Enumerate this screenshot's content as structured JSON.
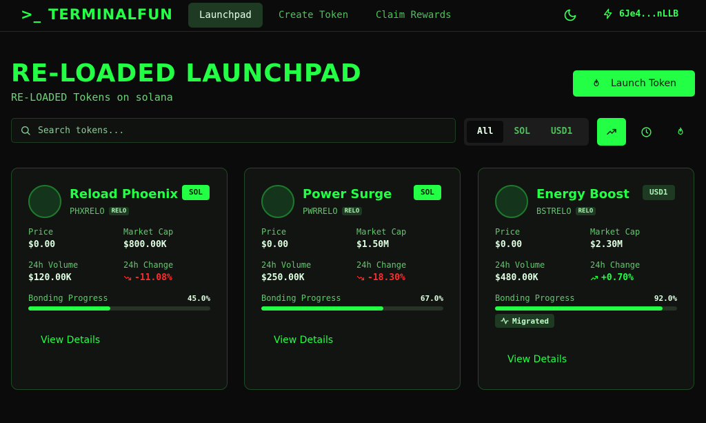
{
  "nav": {
    "logo_prompt": ">_",
    "logo_text": "TERMINALFUN",
    "links": [
      "Launchpad",
      "Create Token",
      "Claim Rewards"
    ],
    "active_link": "Launchpad",
    "wallet": "6Je4...nLLB",
    "theme_icon": "moon-icon",
    "wallet_icon": "bolt-icon"
  },
  "hero": {
    "title": "RE-LOADED LAUNCHPAD",
    "subtitle": "RE-LOADED Tokens on solana",
    "launch_button": "Launch Token"
  },
  "search": {
    "placeholder": "Search tokens..."
  },
  "filters": {
    "options": [
      "All",
      "SOL",
      "USD1"
    ],
    "selected": "All"
  },
  "sort_buttons": [
    "trending-icon",
    "clock-icon",
    "flame-icon"
  ],
  "labels": {
    "price": "Price",
    "market_cap": "Market Cap",
    "volume": "24h Volume",
    "change": "24h Change",
    "bonding": "Bonding Progress",
    "view_details": "View Details",
    "migrated": "Migrated"
  },
  "tokens": [
    {
      "name": "Reload Phoenix",
      "ticker": "PHXRELO",
      "tag": "RELO",
      "quote": "SOL",
      "price": "$0.00",
      "market_cap": "$800.00K",
      "volume": "$120.00K",
      "change": "-11.08%",
      "change_dir": "down",
      "progress_label": "45.0%",
      "progress": 0.45,
      "migrated": false
    },
    {
      "name": "Power Surge",
      "ticker": "PWRRELO",
      "tag": "RELO",
      "quote": "SOL",
      "price": "$0.00",
      "market_cap": "$1.50M",
      "volume": "$250.00K",
      "change": "-18.30%",
      "change_dir": "down",
      "progress_label": "67.0%",
      "progress": 0.67,
      "migrated": false
    },
    {
      "name": "Energy Boost",
      "ticker": "BSTRELO",
      "tag": "RELO",
      "quote": "USD1",
      "price": "$0.00",
      "market_cap": "$2.30M",
      "volume": "$480.00K",
      "change": "+0.70%",
      "change_dir": "up",
      "progress_label": "92.0%",
      "progress": 0.92,
      "migrated": true
    }
  ],
  "colors": {
    "accent": "#22ff44",
    "negative": "#ff2d2d",
    "background": "#0b0b0b"
  }
}
